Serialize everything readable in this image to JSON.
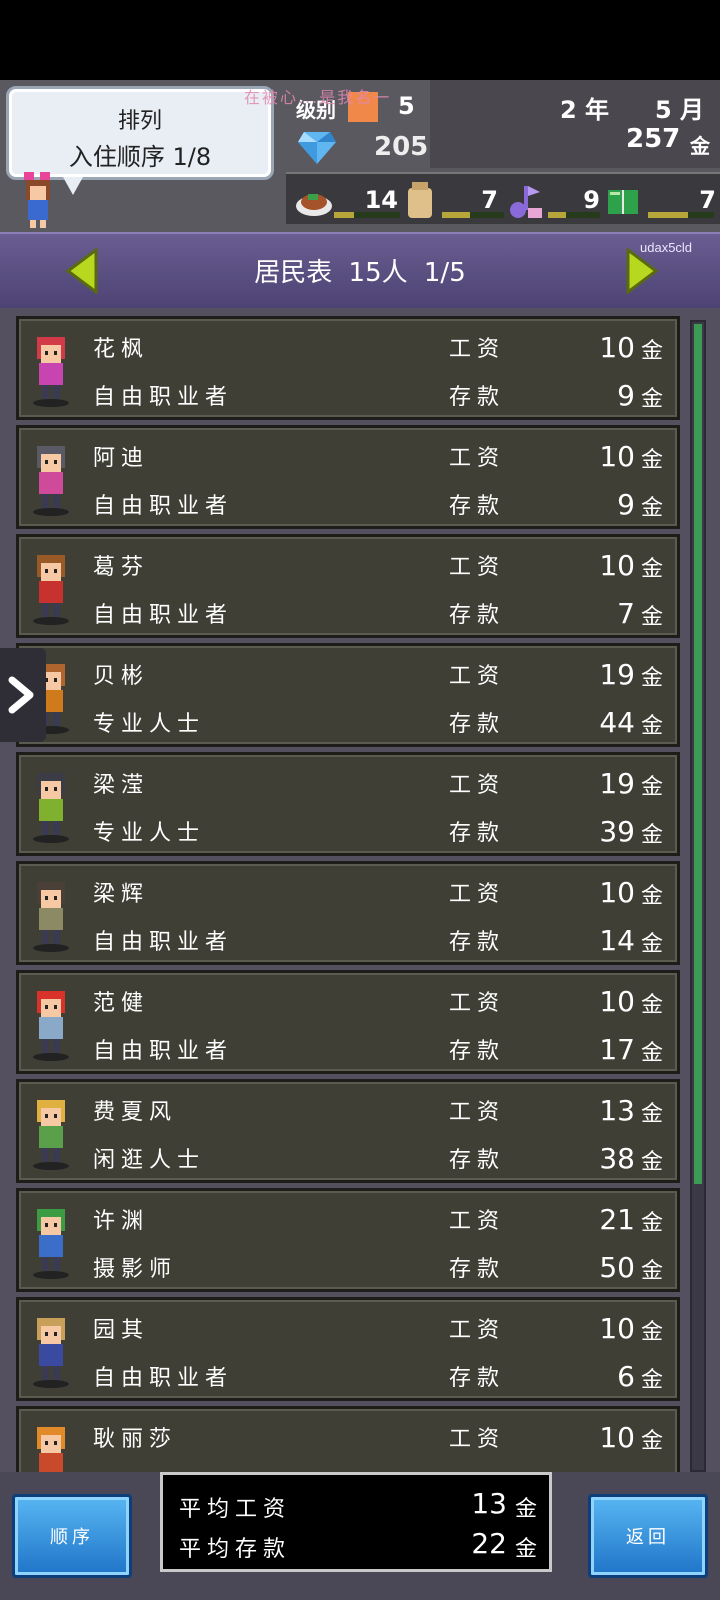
{
  "header": {
    "sort_title": "排列",
    "sort_mode": "入住顺序",
    "sort_page": "1/8",
    "watermark": "在被心...是我名一",
    "level_label": "级别",
    "level_value": "5",
    "year": "2 年",
    "month": "5 月",
    "gems": "205",
    "money": "257",
    "money_unit": "金",
    "resources": [
      {
        "icon": "food-icon",
        "value": "14",
        "fill": 0.3
      },
      {
        "icon": "goods-icon",
        "value": "7",
        "fill": 0.45
      },
      {
        "icon": "music-note-icon",
        "value": "9",
        "fill": 0.35
      },
      {
        "icon": "book-icon",
        "value": "7",
        "fill": 0.6
      }
    ]
  },
  "list_header": {
    "title": "居民表",
    "count": "15人",
    "page": "1/5",
    "code": "udax5cld"
  },
  "labels": {
    "wage": "工资",
    "savings": "存款",
    "gold": "金"
  },
  "residents": [
    {
      "name": "花枫",
      "job": "自由职业者",
      "wage": "10",
      "savings": "9",
      "hair": "#d23a4a",
      "shirt": "#c844b0"
    },
    {
      "name": "阿迪",
      "job": "自由职业者",
      "wage": "10",
      "savings": "9",
      "hair": "#5a5a66",
      "shirt": "#d04a9c"
    },
    {
      "name": "葛芬",
      "job": "自由职业者",
      "wage": "10",
      "savings": "7",
      "hair": "#9a5a28",
      "shirt": "#c8322e"
    },
    {
      "name": "贝彬",
      "job": "专业人士",
      "wage": "19",
      "savings": "44",
      "hair": "#b0652e",
      "shirt": "#d07a1e"
    },
    {
      "name": "梁滢",
      "job": "专业人士",
      "wage": "19",
      "savings": "39",
      "hair": "#3c3c46",
      "shirt": "#7fb02e"
    },
    {
      "name": "梁辉",
      "job": "自由职业者",
      "wage": "10",
      "savings": "14",
      "hair": "#4a4038",
      "shirt": "#8c8a64"
    },
    {
      "name": "范健",
      "job": "自由职业者",
      "wage": "10",
      "savings": "17",
      "hair": "#d8322a",
      "shirt": "#8aa8c8"
    },
    {
      "name": "费夏风",
      "job": "闲逛人士",
      "wage": "13",
      "savings": "38",
      "hair": "#e0b040",
      "shirt": "#5aa04a"
    },
    {
      "name": "许渊",
      "job": "摄影师",
      "wage": "21",
      "savings": "50",
      "hair": "#3c9c44",
      "shirt": "#3a6ec8"
    },
    {
      "name": "园其",
      "job": "自由职业者",
      "wage": "10",
      "savings": "6",
      "hair": "#c8a05a",
      "shirt": "#3a4aa0"
    },
    {
      "name": "耿丽莎",
      "job": "",
      "wage": "10",
      "savings": "",
      "hair": "#e08a2a",
      "shirt": "#c84a2a"
    }
  ],
  "footer": {
    "order_button": "顺序",
    "back_button": "返回",
    "avg_wage_label": "平均工资",
    "avg_wage_value": "13",
    "avg_savings_label": "平均存款",
    "avg_savings_value": "22"
  },
  "colors": {
    "accent_green": "#b8d820",
    "row_bg": "#3f3f36",
    "header_purple": "#5e5287",
    "button_blue": "#2a8ae0"
  }
}
